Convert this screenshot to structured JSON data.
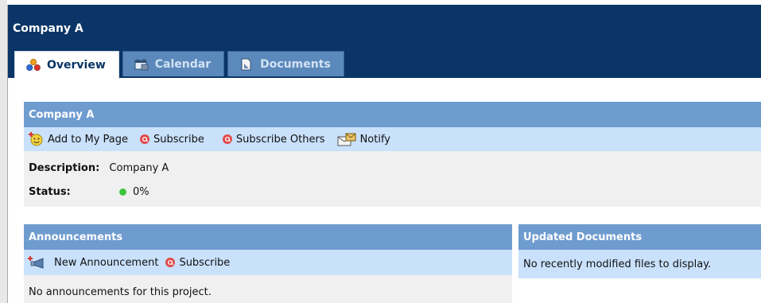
{
  "window": {
    "title": "Company A"
  },
  "tabs": [
    {
      "label": "Overview",
      "icon": "overview-icon",
      "active": true
    },
    {
      "label": "Calendar",
      "icon": "calendar-icon",
      "active": false
    },
    {
      "label": "Documents",
      "icon": "documents-icon",
      "active": false
    }
  ],
  "project_panel": {
    "title": "Company A",
    "actions": {
      "add_to_my_page": "Add to My Page",
      "subscribe": "Subscribe",
      "subscribe_others": "Subscribe Others",
      "notify": "Notify"
    },
    "description_label": "Description:",
    "description_value": "Company A",
    "status_label": "Status:",
    "status_value": "0%"
  },
  "announcements_panel": {
    "title": "Announcements",
    "new_announcement": "New Announcement",
    "subscribe": "Subscribe",
    "empty_text": "No announcements for this project."
  },
  "documents_panel": {
    "title": "Updated Documents",
    "empty_text": "No recently modified files to display."
  },
  "colors": {
    "header_bg": "#0a3566",
    "panel_header": "#6f9ccf",
    "action_bar": "#c9e1fb",
    "status_green": "#3ec43e",
    "subscribe_red": "#e04a4a"
  }
}
